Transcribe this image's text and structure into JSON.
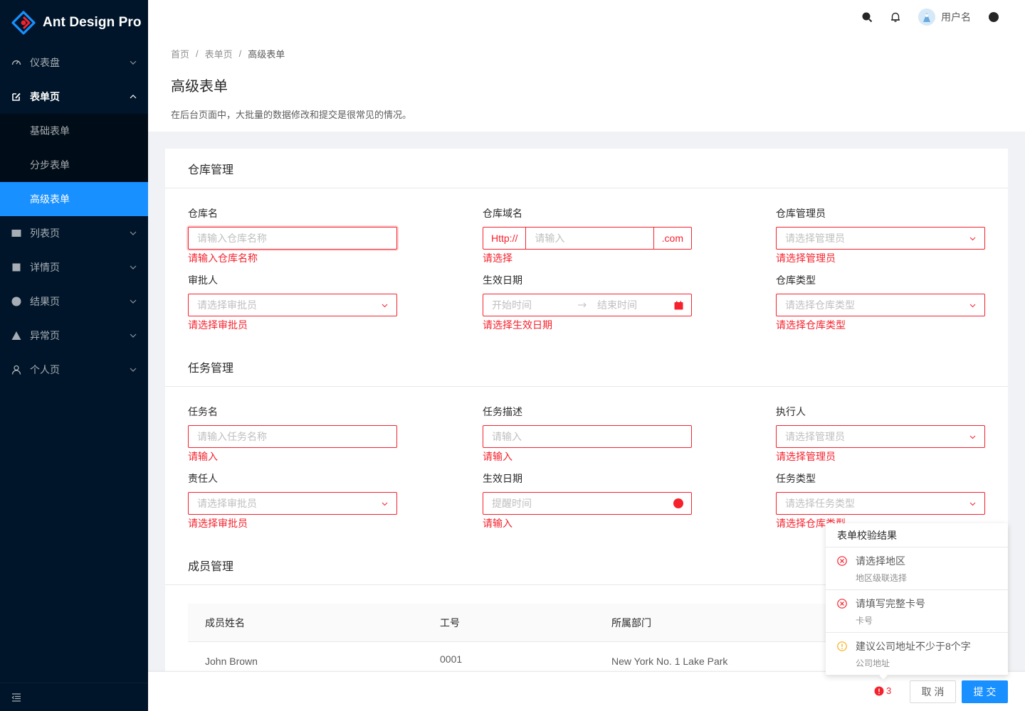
{
  "brand": {
    "name": "Ant Design Pro"
  },
  "sidebar": {
    "items": [
      {
        "label": "仪表盘",
        "icon": "dashboard-icon"
      },
      {
        "label": "表单页",
        "icon": "form-icon",
        "open": true,
        "children": [
          "基础表单",
          "分步表单",
          "高级表单"
        ]
      },
      {
        "label": "列表页",
        "icon": "table-icon"
      },
      {
        "label": "详情页",
        "icon": "profile-icon"
      },
      {
        "label": "结果页",
        "icon": "check-circle-icon"
      },
      {
        "label": "异常页",
        "icon": "warning-icon"
      },
      {
        "label": "个人页",
        "icon": "user-icon"
      }
    ],
    "active_child": "高级表单"
  },
  "header": {
    "username": "用户名"
  },
  "page": {
    "breadcrumb": [
      "首页",
      "表单页",
      "高级表单"
    ],
    "title": "高级表单",
    "description": "在后台页面中，大批量的数据修改和提交是很常见的情况。"
  },
  "warehouse": {
    "title": "仓库管理",
    "name": {
      "label": "仓库名",
      "placeholder": "请输入仓库名称",
      "error": "请输入仓库名称"
    },
    "domain": {
      "label": "仓库域名",
      "prefix": "Http://",
      "placeholder": "请输入",
      "suffix": ".com",
      "error": "请选择"
    },
    "owner": {
      "label": "仓库管理员",
      "placeholder": "请选择管理员",
      "error": "请选择管理员"
    },
    "approver": {
      "label": "审批人",
      "placeholder": "请选择审批员",
      "error": "请选择审批员"
    },
    "date": {
      "label": "生效日期",
      "start": "开始时间",
      "end": "结束时间",
      "error": "请选择生效日期"
    },
    "type": {
      "label": "仓库类型",
      "placeholder": "请选择仓库类型",
      "error": "请选择仓库类型"
    }
  },
  "task": {
    "title": "任务管理",
    "name": {
      "label": "任务名",
      "placeholder": "请输入任务名称",
      "error": "请输入"
    },
    "desc": {
      "label": "任务描述",
      "placeholder": "请输入",
      "error": "请输入"
    },
    "executor": {
      "label": "执行人",
      "placeholder": "请选择管理员",
      "error": "请选择管理员"
    },
    "approver": {
      "label": "责任人",
      "placeholder": "请选择审批员",
      "error": "请选择审批员"
    },
    "date": {
      "label": "生效日期",
      "placeholder": "提醒时间",
      "error": "请输入"
    },
    "type": {
      "label": "任务类型",
      "placeholder": "请选择任务类型",
      "error": "请选择仓库类型"
    }
  },
  "members": {
    "title": "成员管理",
    "columns": [
      "成员姓名",
      "工号",
      "所属部门"
    ],
    "rows": [
      {
        "name": "John Brown",
        "id": "0001",
        "dept": "New York No. 1 Lake Park"
      }
    ]
  },
  "validation": {
    "title": "表单校验结果",
    "items": [
      {
        "level": "error",
        "message": "请选择地区",
        "field": "地区级联选择"
      },
      {
        "level": "error",
        "message": "请填写完整卡号",
        "field": "卡号"
      },
      {
        "level": "warning",
        "message": "建议公司地址不少于8个字",
        "field": "公司地址"
      }
    ],
    "count": "3"
  },
  "footer": {
    "cancel": "取 消",
    "submit": "提 交"
  },
  "colors": {
    "primary": "#1890ff",
    "error": "#f5222d",
    "warning": "#faad14",
    "sider": "#001529"
  }
}
